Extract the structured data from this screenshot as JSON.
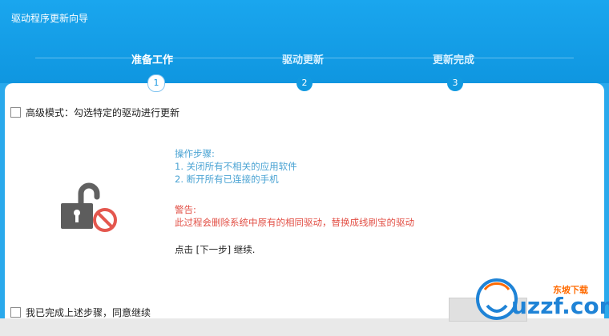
{
  "window": {
    "title": "驱动程序更新向导"
  },
  "steps": [
    {
      "label": "准备工作",
      "number": "1",
      "active": true
    },
    {
      "label": "驱动更新",
      "number": "2",
      "active": false
    },
    {
      "label": "更新完成",
      "number": "3",
      "active": false
    }
  ],
  "advanced_mode": {
    "label": "高级模式：勾选特定的驱动进行更新"
  },
  "instructions": {
    "title": "操作步骤:",
    "items": [
      "1. 关闭所有不相关的应用软件",
      "2. 断开所有已连接的手机"
    ]
  },
  "warning": {
    "title": "警告:",
    "text": "此过程会删除系统中原有的相同驱动，替换成线刷宝的驱动"
  },
  "continue_hint": "点击 [下一步] 继续.",
  "agree": {
    "label": "我已完成上述步骤，同意继续"
  },
  "brand": {
    "text": "uzzf.com",
    "tag": "东坡下载"
  },
  "colors": {
    "accent": "#1aa6ee",
    "info": "#4aa3d3",
    "warning": "#e24f45"
  }
}
